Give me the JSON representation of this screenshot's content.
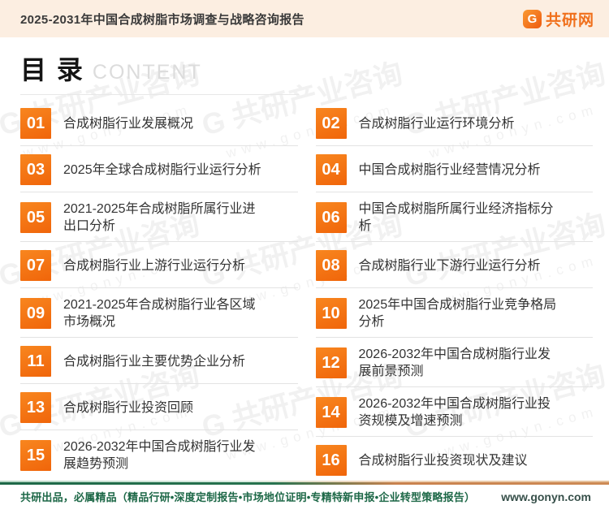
{
  "header": {
    "title": "2025-2031年中国合成树脂市场调查与战略咨询报告",
    "logo": {
      "icon": "G",
      "text": "共研网"
    }
  },
  "toc": {
    "title": "目 录",
    "subtitle": "CONTENT",
    "items": [
      {
        "num": "01",
        "label": "合成树脂行业发展概况"
      },
      {
        "num": "02",
        "label": "合成树脂行业运行环境分析"
      },
      {
        "num": "03",
        "label": "2025年全球合成树脂行业运行分析"
      },
      {
        "num": "04",
        "label": "中国合成树脂行业经营情况分析"
      },
      {
        "num": "05",
        "label": "2021-2025年合成树脂所属行业进\n出口分析"
      },
      {
        "num": "06",
        "label": "中国合成树脂所属行业经济指标分\n析"
      },
      {
        "num": "07",
        "label": "合成树脂行业上游行业运行分析"
      },
      {
        "num": "08",
        "label": "合成树脂行业下游行业运行分析"
      },
      {
        "num": "09",
        "label": "2021-2025年合成树脂行业各区域\n市场概况"
      },
      {
        "num": "10",
        "label": "2025年中国合成树脂行业竞争格局\n分析"
      },
      {
        "num": "11",
        "label": "合成树脂行业主要优势企业分析"
      },
      {
        "num": "12",
        "label": "2026-2032年中国合成树脂行业发\n展前景预测"
      },
      {
        "num": "13",
        "label": "合成树脂行业投资回顾"
      },
      {
        "num": "14",
        "label": "2026-2032年中国合成树脂行业投\n资规模及增速预测"
      },
      {
        "num": "15",
        "label": "2026-2032年中国合成树脂行业发\n展趋势预测"
      },
      {
        "num": "16",
        "label": "合成树脂行业投资现状及建议"
      }
    ]
  },
  "watermark": {
    "logo_text": "G 共研产业咨询",
    "url": "www.gonyn.com"
  },
  "footer": {
    "left": "共研出品，必属精品（精品行研•深度定制报告•市场地位证明•专精特新申报•企业转型策略报告）",
    "right": "www.gonyn.com"
  },
  "colors": {
    "accent_orange": "#f0650a",
    "header_bg": "#fceee1",
    "footer_green": "#1d6847",
    "footer_orange": "#c9824e"
  }
}
